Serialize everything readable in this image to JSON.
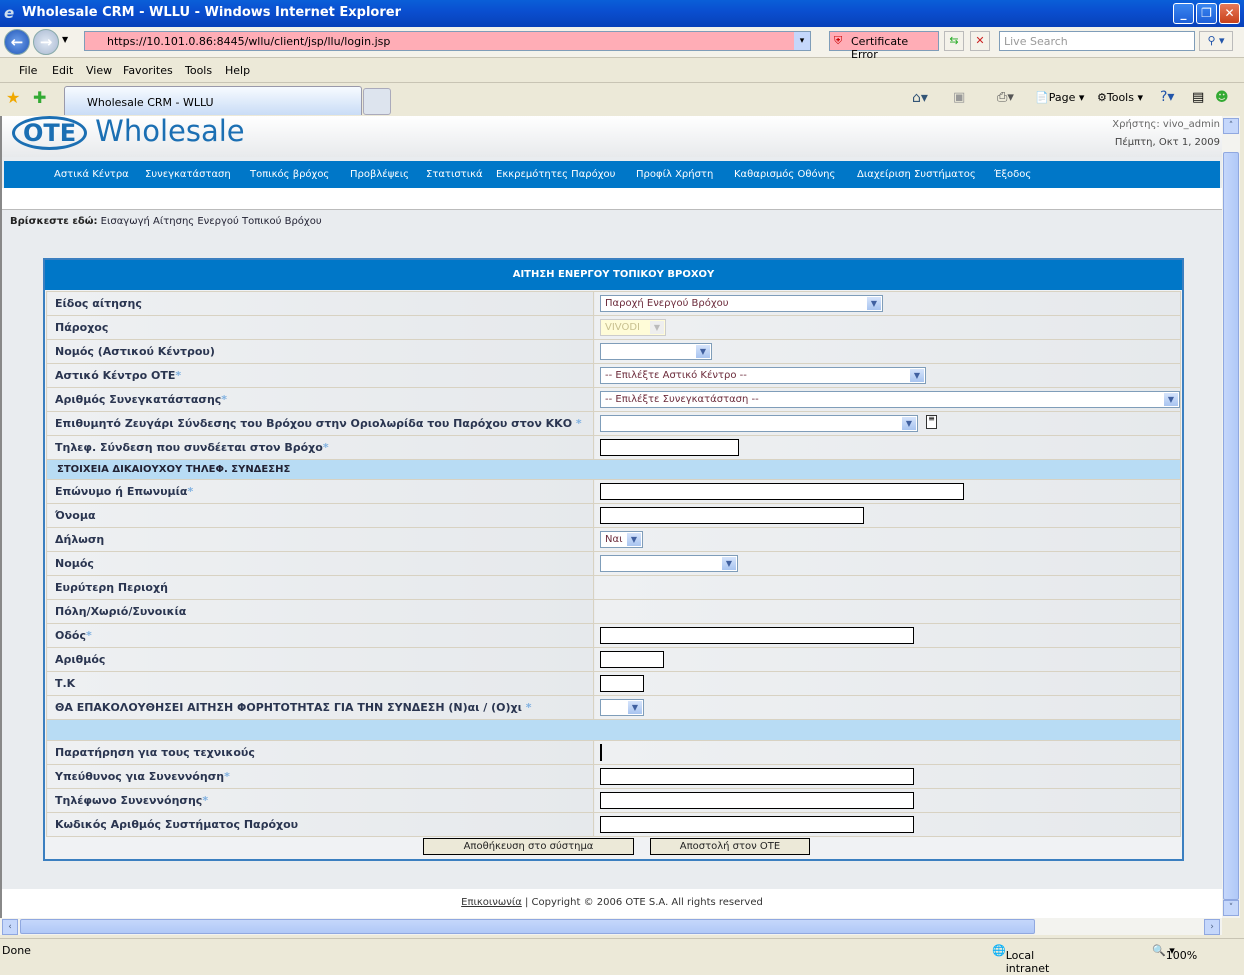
{
  "window": {
    "title": "Wholesale CRM - WLLU - Windows Internet Explorer"
  },
  "browser": {
    "url": "https://10.101.0.86:8445/wllu/client/jsp/llu/login.jsp",
    "cert_error": "Certificate Error",
    "search_placeholder": "Live Search",
    "menu": [
      "File",
      "Edit",
      "View",
      "Favorites",
      "Tools",
      "Help"
    ],
    "tab_title": "Wholesale CRM - WLLU",
    "toolbar": {
      "page": "Page",
      "tools": "Tools"
    },
    "status": {
      "text": "Done",
      "zone": "Local intranet",
      "zoom": "100%"
    }
  },
  "page": {
    "logo": {
      "mark": "OTE",
      "text": "Wholesale"
    },
    "user": "Χρήστης: vivo_admin",
    "date": "Πέμπτη, Οκτ 1, 2009",
    "nav": [
      "Αστικά Κέντρα",
      "Συνεγκατάσταση",
      "Τοπικός βρόχος",
      "Προβλέψεις",
      "Στατιστικά",
      "Εκκρεμότητες Παρόχου",
      "Προφίλ Χρήστη",
      "Καθαρισμός Οθόνης",
      "Διαχείριση Συστήματος",
      "Έξοδος"
    ],
    "breadcrumb": {
      "label": "Βρίσκεστε εδώ:",
      "value": "Εισαγωγή Αίτησης Ενεργού Τοπικού Βρόχου"
    },
    "form": {
      "title": "ΑΙΤΗΣΗ ΕΝΕΡΓΟΥ ΤΟΠΙΚΟΥ ΒΡΟΧΟΥ",
      "rows": [
        {
          "label": "Είδος αίτησης",
          "required": false,
          "field": "select",
          "value": "Παροχή Ενεργού Βρόχου"
        },
        {
          "label": "Πάροχος",
          "required": false,
          "field": "select-disabled",
          "value": "VIVODI"
        },
        {
          "label": "Νομός (Αστικού Κέντρου)",
          "required": false,
          "field": "select",
          "value": ""
        },
        {
          "label": "Αστικό Κέντρο ΟΤΕ",
          "required": true,
          "field": "select",
          "value": "-- Επιλέξτε Αστικό Κέντρο --"
        },
        {
          "label": "Αριθμός Συνεγκατάστασης",
          "required": true,
          "field": "select",
          "value": "-- Επιλέξτε Συνεγκατάσταση --"
        },
        {
          "label": "Επιθυμητό Ζευγάρι Σύνδεσης του Βρόχου στην Οριολωρίδα του Παρόχου στον ΚΚΟ ",
          "required": true,
          "field": "select-note",
          "value": ""
        },
        {
          "label": "Τηλεφ. Σύνδεση που συνδέεται στον Βρόχο",
          "required": true,
          "field": "text",
          "value": ""
        },
        {
          "section": "ΣΤΟΙΧΕΙΑ ΔΙΚΑΙΟΥΧΟΥ ΤΗΛΕΦ. ΣΥΝΔΕΣΗΣ"
        },
        {
          "label": "Επώνυμο ή Επωνυμία",
          "required": true,
          "field": "text",
          "value": ""
        },
        {
          "label": "Όνομα",
          "required": false,
          "field": "text",
          "value": ""
        },
        {
          "label": "Δήλωση",
          "required": false,
          "field": "select",
          "value": "Ναι"
        },
        {
          "label": "Νομός",
          "required": false,
          "field": "select",
          "value": ""
        },
        {
          "label": "Ευρύτερη Περιοχή",
          "required": false,
          "field": "none"
        },
        {
          "label": "Πόλη/Χωριό/Συνοικία",
          "required": false,
          "field": "none"
        },
        {
          "label": "Οδός",
          "required": true,
          "field": "text",
          "value": ""
        },
        {
          "label": "Αριθμός",
          "required": false,
          "field": "text",
          "value": ""
        },
        {
          "label": "Τ.Κ",
          "required": false,
          "field": "text",
          "value": ""
        },
        {
          "label": "ΘΑ ΕΠΑΚΟΛΟΥΘΗΣΕΙ ΑΙΤΗΣΗ ΦΟΡΗΤΟΤΗΤΑΣ ΓΙΑ ΤΗΝ ΣΥΝΔΕΣΗ (Ν)αι / (Ο)χι ",
          "required": true,
          "field": "select",
          "value": ""
        },
        {
          "section": ""
        },
        {
          "label": "Παρατήρηση για τους τεχνικούς",
          "required": false,
          "field": "text",
          "value": ""
        },
        {
          "label": "Υπεύθυνος για Συνεννόηση",
          "required": true,
          "field": "text",
          "value": ""
        },
        {
          "label": "Τηλέφωνο Συνεννόησης",
          "required": true,
          "field": "text",
          "value": ""
        },
        {
          "label": "Κωδικός Αριθμός Συστήματος Παρόχου",
          "required": false,
          "field": "text",
          "value": ""
        }
      ],
      "save_button": "Αποθήκευση στο σύστημα",
      "send_button": "Αποστολή στον ΟΤΕ"
    },
    "footer": {
      "link": "Επικοινωνία",
      "copyright": "Copyright © 2006 OTE S.A. All rights reserved"
    }
  },
  "colors": {
    "nav": "#0077c8",
    "section": "#b8dcf4",
    "label": "#2a3550",
    "url_error": "#ffadb6"
  }
}
